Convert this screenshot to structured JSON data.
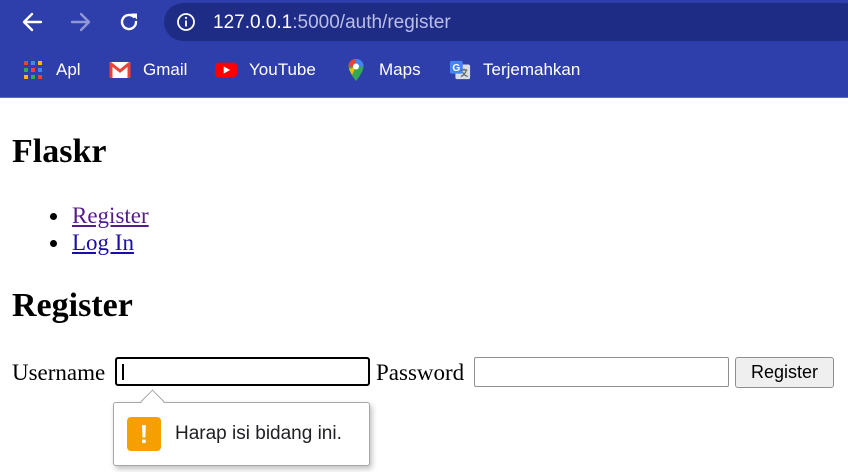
{
  "browser": {
    "url": {
      "host": "127.0.0.1",
      "rest": ":5000/auth/register"
    },
    "bookmarks": [
      {
        "label": "Apl",
        "icon": "apps-grid-icon"
      },
      {
        "label": "Gmail",
        "icon": "gmail-icon"
      },
      {
        "label": "YouTube",
        "icon": "youtube-icon"
      },
      {
        "label": "Maps",
        "icon": "maps-icon"
      },
      {
        "label": "Terjemahkan",
        "icon": "translate-icon"
      }
    ],
    "colors": {
      "toolbar": "#2e3eaa",
      "omnibox": "#1f2c86"
    }
  },
  "page": {
    "site_title": "Flaskr",
    "nav": [
      {
        "label": "Register"
      },
      {
        "label": "Log In"
      }
    ],
    "section_title": "Register",
    "form": {
      "username_label": "Username",
      "username_value": "",
      "password_label": "Password",
      "password_value": "",
      "submit_label": "Register"
    },
    "validation_tooltip": {
      "message": "Harap isi bidang ini.",
      "icon": "warning-icon",
      "icon_color": "#f5a000"
    }
  }
}
